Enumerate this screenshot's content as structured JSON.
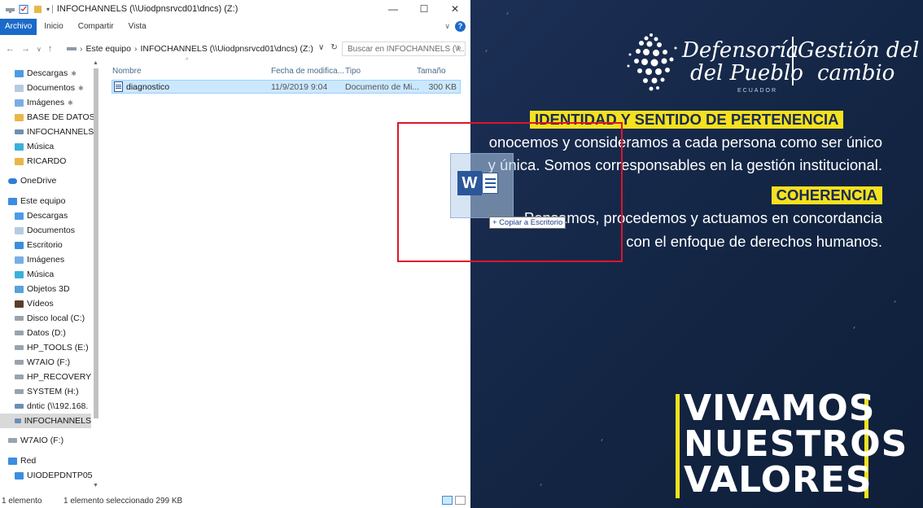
{
  "explorer": {
    "title": "INFOCHANNELS (\\\\Uiodpnsrvcd01\\dncs) (Z:)",
    "ribbon_tabs": [
      "Archivo",
      "Inicio",
      "Compartir",
      "Vista"
    ],
    "address_crumbs": [
      "Este equipo",
      "INFOCHANNELS (\\\\Uiodpnsrvcd01\\dncs) (Z:)"
    ],
    "search_placeholder": "Buscar en INFOCHANNELS (\\\\...",
    "nav_items": [
      {
        "label": "Descargas",
        "icon": "download-folder-icon",
        "pinned": true
      },
      {
        "label": "Documentos",
        "icon": "documents-folder-icon",
        "pinned": true
      },
      {
        "label": "Imágenes",
        "icon": "pictures-folder-icon",
        "pinned": true
      },
      {
        "label": "BASE DE DATOS",
        "icon": "folder-icon"
      },
      {
        "label": "INFOCHANNELS",
        "icon": "network-drive-icon"
      },
      {
        "label": "Música",
        "icon": "music-folder-icon"
      },
      {
        "label": "RICARDO",
        "icon": "folder-icon"
      },
      {
        "label": "OneDrive",
        "icon": "onedrive-icon"
      },
      {
        "label": "Este equipo",
        "icon": "this-pc-icon"
      },
      {
        "label": "Descargas",
        "icon": "download-folder-icon"
      },
      {
        "label": "Documentos",
        "icon": "documents-folder-icon"
      },
      {
        "label": "Escritorio",
        "icon": "desktop-folder-icon"
      },
      {
        "label": "Imágenes",
        "icon": "pictures-folder-icon"
      },
      {
        "label": "Música",
        "icon": "music-folder-icon"
      },
      {
        "label": "Objetos 3D",
        "icon": "3d-objects-folder-icon"
      },
      {
        "label": "Vídeos",
        "icon": "videos-folder-icon"
      },
      {
        "label": "Disco local (C:)",
        "icon": "local-disk-icon"
      },
      {
        "label": "Datos (D:)",
        "icon": "drive-icon"
      },
      {
        "label": "HP_TOOLS (E:)",
        "icon": "drive-icon"
      },
      {
        "label": "W7AIO (F:)",
        "icon": "usb-drive-icon"
      },
      {
        "label": "HP_RECOVERY (",
        "icon": "drive-icon"
      },
      {
        "label": "SYSTEM (H:)",
        "icon": "drive-icon"
      },
      {
        "label": "dntic (\\\\192.168.",
        "icon": "network-drive-icon"
      },
      {
        "label": "INFOCHANNELS",
        "icon": "network-drive-icon",
        "selected": true
      },
      {
        "label": "W7AIO (F:)",
        "icon": "usb-drive-icon"
      },
      {
        "label": "Red",
        "icon": "network-icon"
      },
      {
        "label": "UIODEPDNTP05",
        "icon": "computer-icon"
      }
    ],
    "columns": [
      "Nombre",
      "Fecha de modifica...",
      "Tipo",
      "Tamaño"
    ],
    "files": [
      {
        "name": "diagnostico",
        "date": "11/9/2019 9:04",
        "type": "Documento de Mi...",
        "size": "300 KB"
      }
    ],
    "status": {
      "count": "1 elemento",
      "selection": "1 elemento seleccionado  299 KB"
    }
  },
  "drag": {
    "tooltip": "+ Copiar a Escritorio"
  },
  "poster": {
    "logo_line1": "Defensoría",
    "logo_line2": "del Pueblo",
    "logo_country": "ECUADOR",
    "logo_right1": "Gestión del",
    "logo_right2": "cambio",
    "heading1": "IDENTIDAD Y SENTIDO DE PERTENENCIA",
    "line1": "onocemos y consideramos a cada persona como ser único",
    "line2": "y única. Somos corresponsables en la gestión institucional.",
    "heading2": "COHERENCIA",
    "line3": "Pensamos, procedemos y actuamos en concordancia",
    "line4": "con el enfoque de derechos humanos.",
    "slogan": [
      "VIVAMOS",
      "NUESTROS",
      "VALORES"
    ],
    "colors": {
      "background": "#162a4d",
      "accent": "#f5e11f"
    }
  }
}
